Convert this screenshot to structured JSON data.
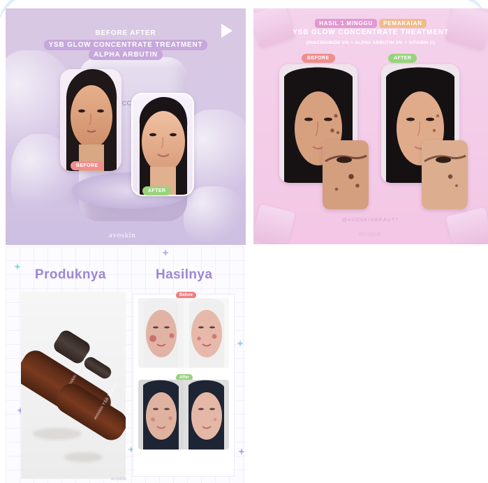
{
  "tiles": {
    "tile1": {
      "title_line_1": "BEFORE AFTER",
      "title_line_2": "YSB GLOW CONCENTRATE TREATMENT",
      "title_line_3": "ALPHA ARBUTIN",
      "jar_text": "YO\nCC\nTB\n3",
      "before_label": "BEFORE",
      "after_label": "AFTER",
      "brand": "avoskin",
      "play_icon": "play-icon"
    },
    "tile2": {
      "heading_tag_1": "HASIL 1 MINGGU",
      "heading_tag_2": "PEMAKAIAN",
      "heading_line_2": "YSB GLOW CONCENTRATE TREATMENT",
      "heading_line_3": "(NIACINAMIDE 5% + ALPHA ARBUTIN 2% + VITAMIN C)",
      "before_label": "BEFORE",
      "after_label": "AFTER",
      "footer_text": "@AVOSKINBEAUTY",
      "brand": "avoskin"
    },
    "tile3": {
      "left_title": "Produknya",
      "right_title": "Hasilnya",
      "before_label": "Before",
      "after_label": "After",
      "bottle_large_label": "avoskin\nYSB\nGLOW",
      "bottle_small_label": "avoskin\nYSB\nSERUM",
      "brand": "avoskin"
    }
  },
  "colors": {
    "lavender": "#d8c8e3",
    "pink": "#f3c7e5",
    "white": "#ffffff",
    "before_pill": "#f08e8e",
    "after_pill": "#99d47c",
    "purple_text": "#9d87d2"
  }
}
